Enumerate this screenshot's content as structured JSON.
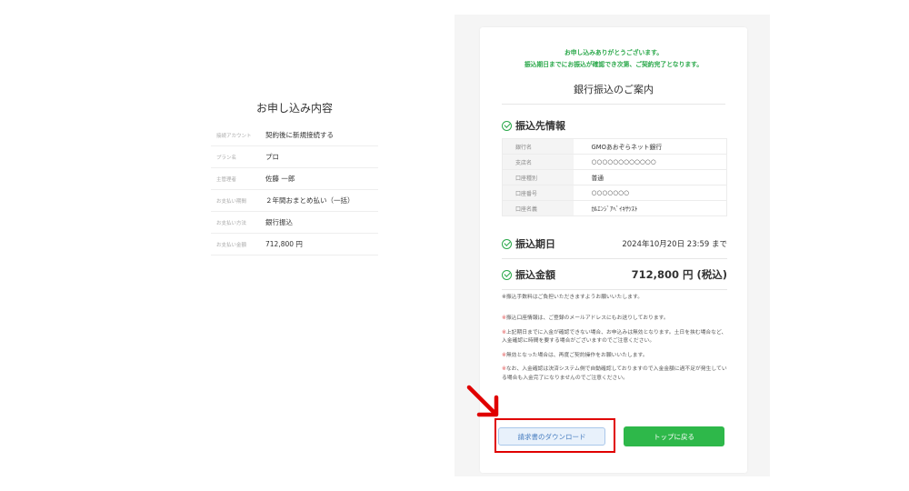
{
  "summary": {
    "title": "お申し込み内容",
    "rows": [
      {
        "label": "接続アカウント",
        "value": "契約後に新規接続する"
      },
      {
        "label": "プラン名",
        "value": "プロ"
      },
      {
        "label": "主管理者",
        "value": "佐藤 一郎"
      },
      {
        "label": "お支払い期間",
        "value": "２年間おまとめ払い（一括）"
      },
      {
        "label": "お支払い方法",
        "value": "銀行振込"
      },
      {
        "label": "お支払い金額",
        "value": "712,800 円"
      }
    ]
  },
  "guide": {
    "thanks_line1": "お申し込みありがとうございます。",
    "thanks_line2": "振込期日までにお振込が確認でき次第、ご契約完了となります。",
    "title": "銀行振込のご案内",
    "transfer_info_title": "振込先情報",
    "bank_rows": [
      {
        "label": "銀行名",
        "value": "GMOあおぞらネット銀行"
      },
      {
        "label": "支店名",
        "value": "○○○○○○○○○○○○"
      },
      {
        "label": "口座種別",
        "value": "普通"
      },
      {
        "label": "口座番号",
        "value": "○○○○○○○"
      },
      {
        "label": "口座名義",
        "value": "ｶﾙｴﾝｼﾞｱﾍﾞｲｷｻﾂｽﾄ"
      }
    ],
    "deadline_title": "振込期日",
    "deadline_value": "2024年10月20日 23:59 まで",
    "amount_title": "振込金額",
    "amount_value": "712,800 円 (税込)",
    "fee_note": "※振込手数料はご負担いただきますようお願いいたします。",
    "notes": [
      {
        "mark": "※",
        "text": "振込口座情報は、ご登録のメールアドレスにもお送りしております。"
      },
      {
        "mark": "※",
        "text": "上記期日までに入金が確認できない場合、お申込みは無効となります。土日を挟む場合など、入金確認に時間を要する場合がございますのでご注意ください。"
      },
      {
        "mark": "※",
        "text": "無効となった場合は、再度ご契約操作をお願いいたします。"
      },
      {
        "mark": "※",
        "text": "なお、入金確認は決済システム側で自動確認しておりますので入金金額に過不足が発生している場合も入金完了になりませんのでご注意ください。"
      }
    ],
    "download_label": "請求書のダウンロード",
    "top_label": "トップに戻る"
  },
  "colors": {
    "accent_green": "#2eb84a",
    "highlight_red": "#e00000",
    "download_blue": "#4a7fc1"
  }
}
